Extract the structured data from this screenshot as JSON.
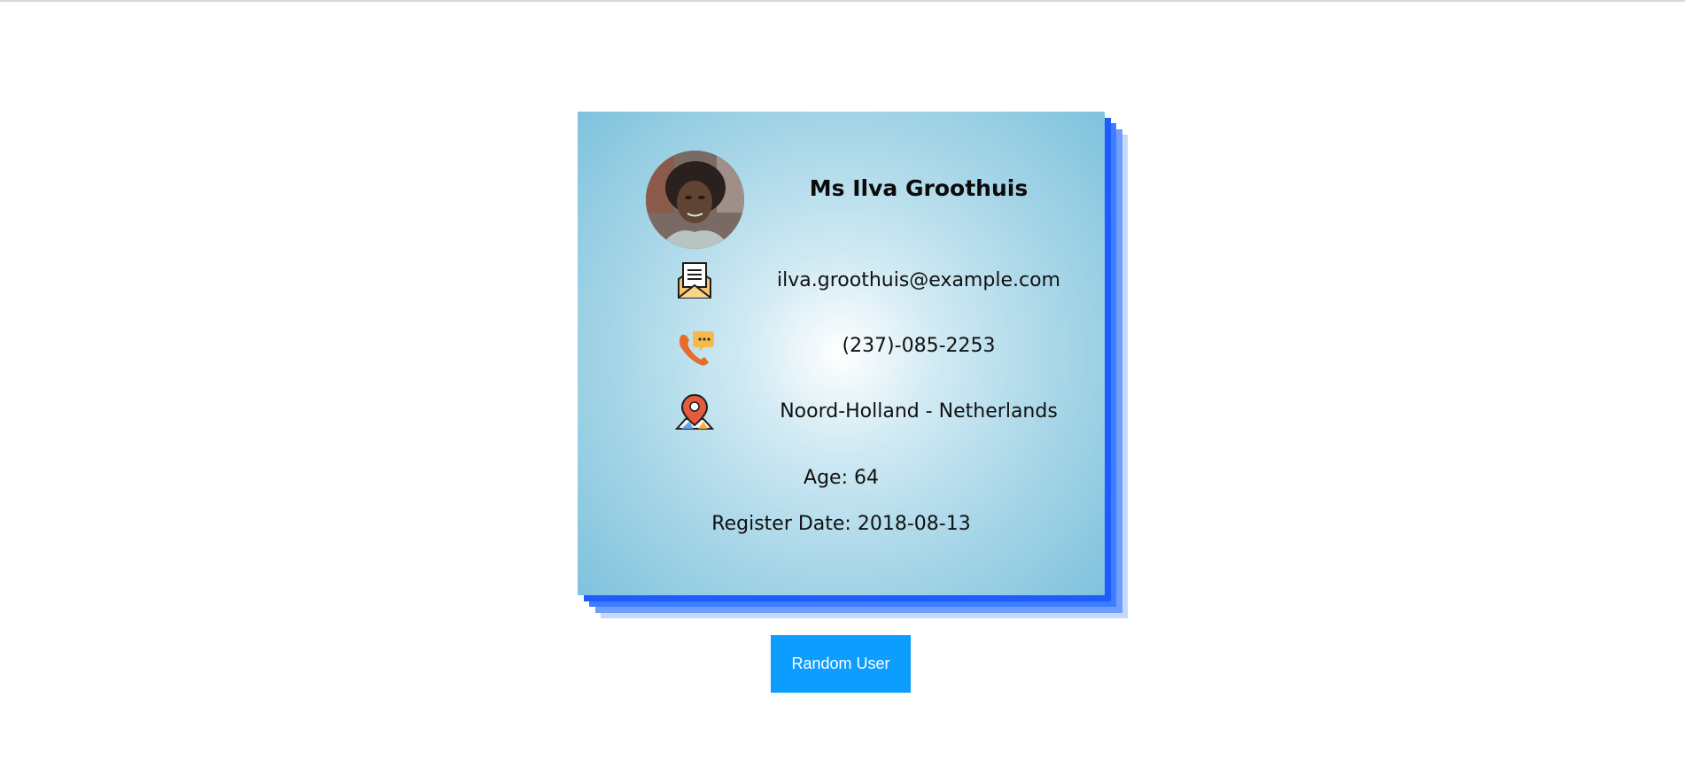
{
  "profile": {
    "name": "Ms Ilva Groothuis",
    "email": "ilva.groothuis@example.com",
    "phone": "(237)-085-2253",
    "location": "Noord-Holland - Netherlands",
    "age": "Age: 64",
    "register_date": "Register Date: 2018-08-13"
  },
  "icons": {
    "avatar": "user-photo",
    "email": "mail-envelope-icon",
    "phone": "phone-chat-icon",
    "location": "map-pin-icon"
  },
  "actions": {
    "random_user_label": "Random User"
  },
  "colors": {
    "button": "#0d9dff",
    "card_shadow": "#1f5cff",
    "card_edge": "#7fc2dd"
  }
}
